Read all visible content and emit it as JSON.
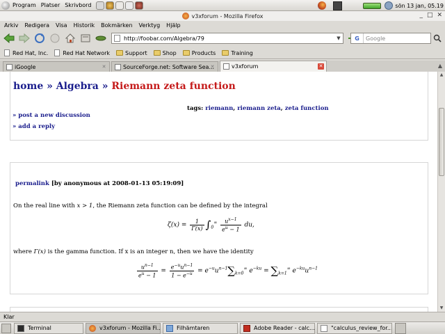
{
  "top_panel": {
    "menus": [
      "Program",
      "Platser",
      "Skrivbord"
    ],
    "clock": "sön 13 jan, 05.19"
  },
  "window": {
    "title": "v3xforum - Mozilla Firefox"
  },
  "menubar": [
    "Arkiv",
    "Redigera",
    "Visa",
    "Historik",
    "Bokmärken",
    "Verktyg",
    "Hjälp"
  ],
  "navbar": {
    "url": "http://foobar.com/Algebra/79",
    "search_placeholder": "Google",
    "search_engine_glyph": "G"
  },
  "bookmarks": [
    {
      "label": "Red Hat, Inc.",
      "kind": "page"
    },
    {
      "label": "Red Hat Network",
      "kind": "page"
    },
    {
      "label": "Support",
      "kind": "folder"
    },
    {
      "label": "Shop",
      "kind": "folder"
    },
    {
      "label": "Products",
      "kind": "folder"
    },
    {
      "label": "Training",
      "kind": "folder"
    }
  ],
  "tabs": [
    {
      "label": "iGoogle"
    },
    {
      "label": "SourceForge.net: Software Sea..."
    },
    {
      "label": "v3xforum"
    }
  ],
  "page": {
    "breadcrumb": {
      "home": "home",
      "sep": "»",
      "section": "Algebra",
      "current": "Riemann zeta function"
    },
    "tags_label": "tags:",
    "tags": [
      "riemann",
      "riemann zeta",
      "zeta function"
    ],
    "actions": [
      "» post a new discussion",
      "» add a reply"
    ],
    "post": {
      "permalink": "permalink",
      "meta": "[by anonymous at 2008-01-13 05:19:09]",
      "text1_a": "On the real line with ",
      "text1_b": "x > 1",
      "text1_c": ", the Riemann zeta function can be defined by the integral",
      "text2_a": "where ",
      "text2_b": "Γ(x)",
      "text2_c": " is the gamma function. If x is an integer n, then we have the identity"
    }
  },
  "status": "Klar",
  "taskbar": [
    {
      "label": "Terminal",
      "icon": "terminal-icon"
    },
    {
      "label": "v3xforum - Mozilla Fi...",
      "icon": "firefox-icon"
    },
    {
      "label": "Filhämtaren",
      "icon": "downloads-icon"
    },
    {
      "label": "Adobe Reader - calc...",
      "icon": "pdf-icon"
    },
    {
      "label": "\"calculus_review_for...",
      "icon": "text-icon"
    }
  ]
}
